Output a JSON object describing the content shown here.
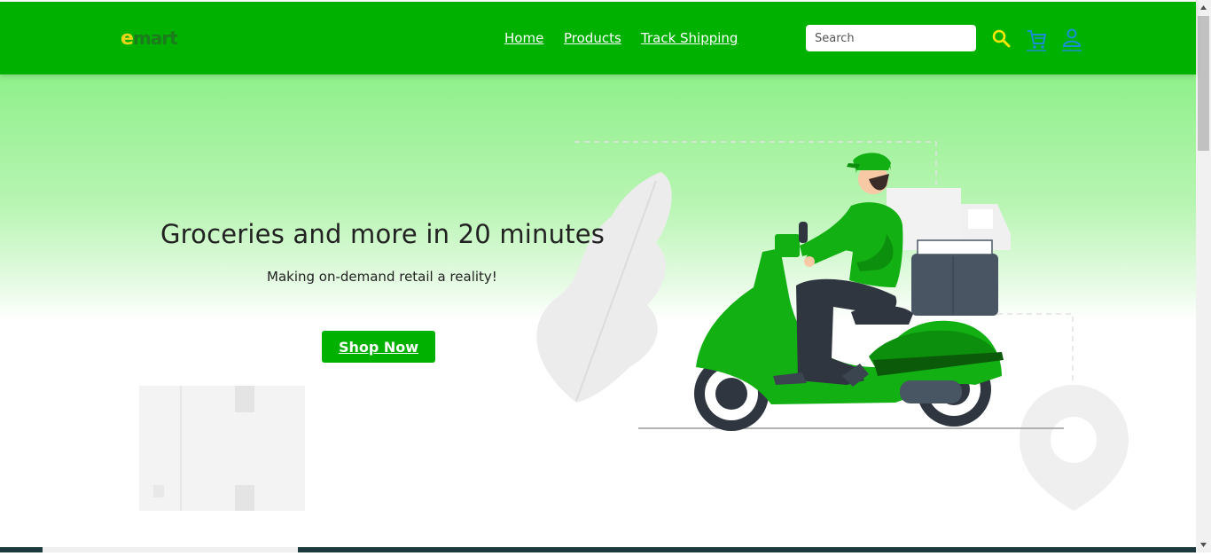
{
  "brand": {
    "logo_first": "e",
    "logo_rest": "mart"
  },
  "nav": {
    "links": [
      {
        "label": "Home"
      },
      {
        "label": "Products"
      },
      {
        "label": "Track Shipping"
      }
    ],
    "search_placeholder": "Search",
    "icons": [
      "search-icon",
      "cart-icon",
      "user-icon"
    ]
  },
  "hero": {
    "title": "Groceries and more in 20 minutes",
    "subtitle": "Making on-demand retail a reality!",
    "cta_label": "Shop Now"
  },
  "colors": {
    "brand_green": "#00b100",
    "logo_yellow": "#e8d51a",
    "icon_yellow": "#ffe800",
    "icon_blue": "#1a8fd6",
    "scooter_green": "#13b013"
  }
}
